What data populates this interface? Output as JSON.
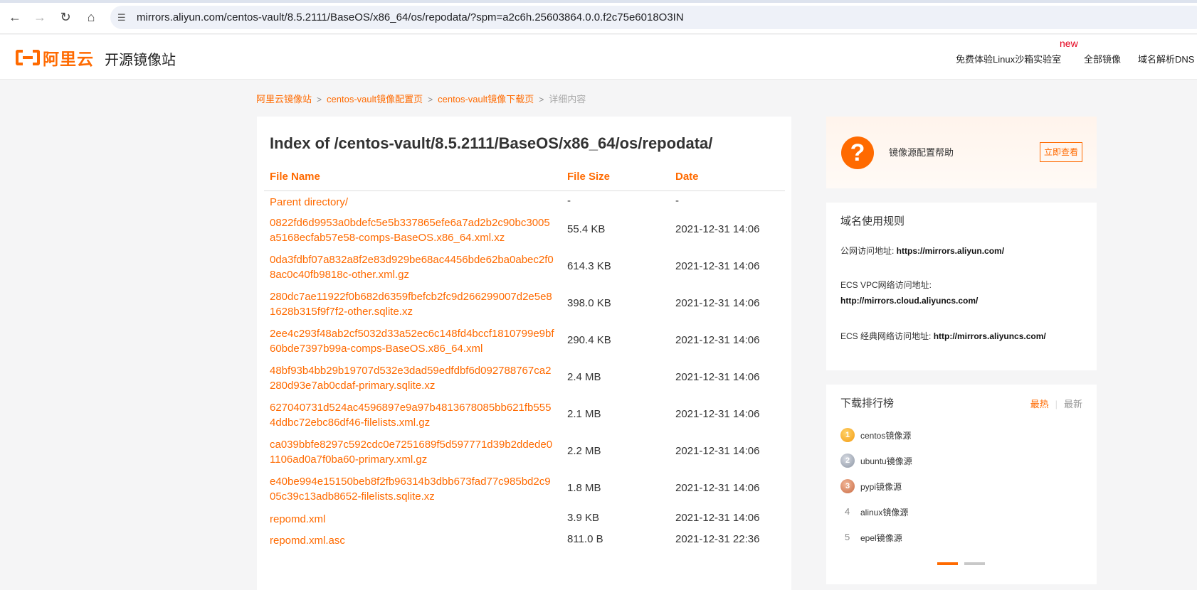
{
  "browser": {
    "url": "mirrors.aliyun.com/centos-vault/8.5.2111/BaseOS/x86_64/os/repodata/?spm=a2c6h.25603864.0.0.f2c75e6018O3IN"
  },
  "header": {
    "logo_text": "阿里云",
    "site_name": "开源镜像站",
    "new_badge": "new",
    "links": [
      "免费体验Linux沙箱实验室",
      "全部镜像",
      "域名解析DNS"
    ]
  },
  "breadcrumb": {
    "items": [
      "阿里云镜像站",
      "centos-vault镜像配置页",
      "centos-vault镜像下载页"
    ],
    "separator": ">",
    "current": "详细内容"
  },
  "listing": {
    "title": "Index of /centos-vault/8.5.2111/BaseOS/x86_64/os/repodata/",
    "columns": [
      "File Name",
      "File Size",
      "Date"
    ],
    "rows": [
      {
        "name": "Parent directory/",
        "size": "-",
        "date": "-"
      },
      {
        "name": "0822fd6d9953a0bdefc5e5b337865efe6a7ad2b2c90bc3005a5168ecfab57e58-comps-BaseOS.x86_64.xml.xz",
        "size": "55.4 KB",
        "date": "2021-12-31 14:06"
      },
      {
        "name": "0da3fdbf07a832a8f2e83d929be68ac4456bde62ba0abec2f08ac0c40fb9818c-other.xml.gz",
        "size": "614.3 KB",
        "date": "2021-12-31 14:06"
      },
      {
        "name": "280dc7ae11922f0b682d6359fbefcb2fc9d266299007d2e5e81628b315f9f7f2-other.sqlite.xz",
        "size": "398.0 KB",
        "date": "2021-12-31 14:06"
      },
      {
        "name": "2ee4c293f48ab2cf5032d33a52ec6c148fd4bccf1810799e9bf60bde7397b99a-comps-BaseOS.x86_64.xml",
        "size": "290.4 KB",
        "date": "2021-12-31 14:06"
      },
      {
        "name": "48bf93b4bb29b19707d532e3dad59edfdbf6d092788767ca2280d93e7ab0cdaf-primary.sqlite.xz",
        "size": "2.4 MB",
        "date": "2021-12-31 14:06"
      },
      {
        "name": "627040731d524ac4596897e9a97b4813678085bb621fb5554ddbc72ebc86df46-filelists.xml.gz",
        "size": "2.1 MB",
        "date": "2021-12-31 14:06"
      },
      {
        "name": "ca039bbfe8297c592cdc0e7251689f5d597771d39b2ddede01106ad0a7f0ba60-primary.xml.gz",
        "size": "2.2 MB",
        "date": "2021-12-31 14:06"
      },
      {
        "name": "e40be994e15150beb8f2fb96314b3dbb673fad77c985bd2c905c39c13adb8652-filelists.sqlite.xz",
        "size": "1.8 MB",
        "date": "2021-12-31 14:06"
      },
      {
        "name": "repomd.xml",
        "size": "3.9 KB",
        "date": "2021-12-31 14:06"
      },
      {
        "name": "repomd.xml.asc",
        "size": "811.0 B",
        "date": "2021-12-31 22:36"
      }
    ]
  },
  "help_card": {
    "icon": "?",
    "text": "镜像源配置帮助",
    "button": "立即查看"
  },
  "rules_card": {
    "title": "域名使用规则",
    "public_label": "公网访问地址: ",
    "public_url": "https://mirrors.aliyun.com/",
    "vpc_label": "ECS VPC网络访问地址:",
    "vpc_url": "http://mirrors.cloud.aliyuncs.com/",
    "classic_label": "ECS 经典网络访问地址: ",
    "classic_url": "http://mirrors.aliyuncs.com/"
  },
  "rank_card": {
    "title": "下载排行榜",
    "tab_hot": "最热",
    "tab_new": "最新",
    "divider": "|",
    "items": [
      {
        "rank": "1",
        "label": "centos镜像源"
      },
      {
        "rank": "2",
        "label": "ubuntu镜像源"
      },
      {
        "rank": "3",
        "label": "pypi镜像源"
      },
      {
        "rank": "4",
        "label": "alinux镜像源"
      },
      {
        "rank": "5",
        "label": "epel镜像源"
      }
    ]
  },
  "colors": {
    "accent": "#ff6a00",
    "background": "#f5f5f6"
  }
}
